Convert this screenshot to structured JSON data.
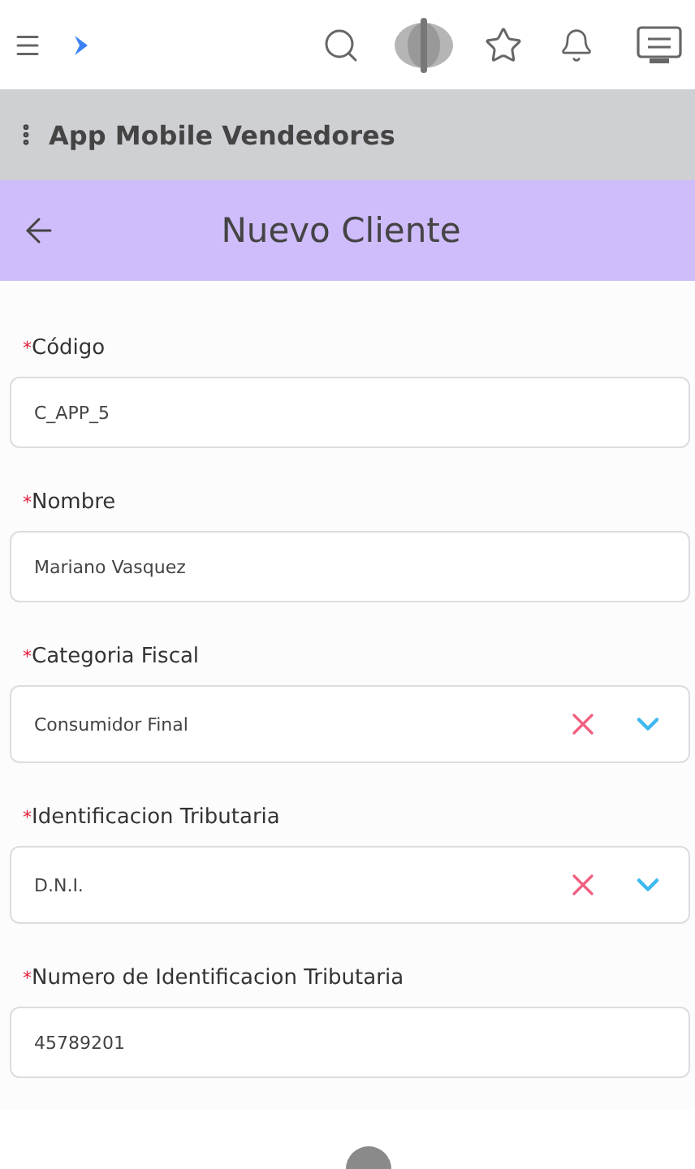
{
  "app_bar": {
    "title": "App Mobile Vendedores"
  },
  "header": {
    "title": "Nuevo Cliente"
  },
  "fields": [
    {
      "kind": "text",
      "required_mark": "*",
      "label": "Código",
      "value": "C_APP_5"
    },
    {
      "kind": "text",
      "required_mark": "*",
      "label": "Nombre",
      "value": "Mariano Vasquez"
    },
    {
      "kind": "select",
      "required_mark": "*",
      "label": "Categoria Fiscal",
      "value": "Consumidor Final"
    },
    {
      "kind": "select",
      "required_mark": "*",
      "label": "Identificacion Tributaria",
      "value": "D.N.I."
    },
    {
      "kind": "text",
      "required_mark": "*",
      "label": "Numero de Identificacion Tributaria",
      "value": "45789201"
    }
  ]
}
